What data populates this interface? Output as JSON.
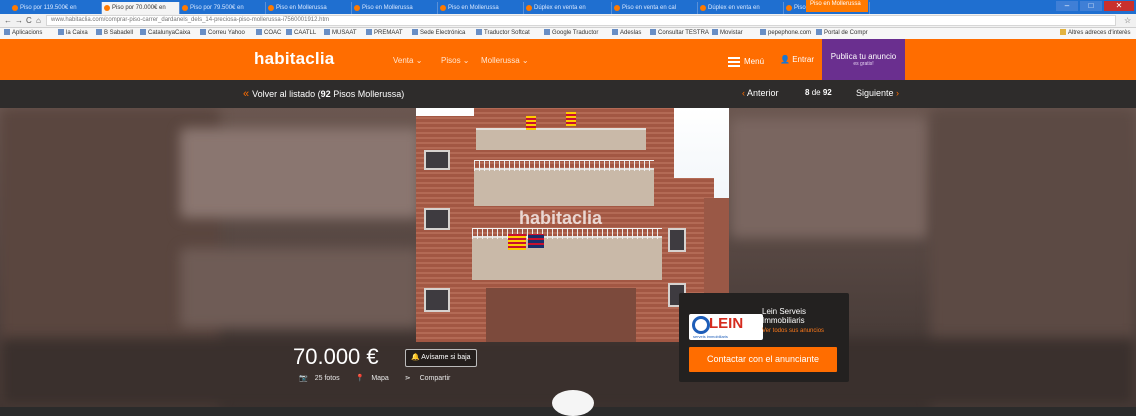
{
  "browser": {
    "tabs": [
      "Piso por 119.500€ en",
      "Piso por 70.000€ en",
      "Piso por 79.500€ en",
      "Piso en Mollerussa",
      "Piso en Mollerussa",
      "Piso en Mollerussa",
      "Dúplex en venta en",
      "Piso en venta en cal",
      "Dúplex en venta en",
      "Piso en venta en Alc"
    ],
    "tab_preview": "Piso en Mollerussa",
    "url": "www.habitaclia.com/comprar-piso-carrer_dardanels_dels_14-preciosa-piso-mollerussa-i7560001912.htm",
    "bookmarks": [
      "Aplicacions",
      "la Caixa",
      "B Sabadell",
      "CatalunyaCaixa",
      "Correu Yahoo",
      "COAC",
      "CAATLL",
      "MUSAAT",
      "PREMAAT",
      "Sede Electrónica",
      "Traductor Softcat",
      "Google Traductor",
      "Adeslas",
      "Consultar TESTRA",
      "Movistar",
      "pepephone.com",
      "Portal de Compr"
    ],
    "bookmarks_other": "Altres adreces d'interès"
  },
  "site": {
    "logo": "habitaclia",
    "nav": [
      "Venta ⌄",
      "Pisos ⌄",
      "Mollerussa ⌄"
    ],
    "menu": "Menú",
    "entrar": "Entrar",
    "publica_title": "Publica tu anuncio",
    "publica_sub": "es gratis!"
  },
  "subnav": {
    "back_prefix": "Volver al listado (",
    "back_count": "92",
    "back_suffix": " Pisos Mollerussa)",
    "prev": "Anterior",
    "current": "8",
    "of": "de",
    "total": "92",
    "next": "Siguiente"
  },
  "listing": {
    "watermark": "habitaclia",
    "price": "70.000 €",
    "alert_button": "Avísame si baja",
    "photos": "25 fotos",
    "map": "Mapa",
    "share": "Compartir"
  },
  "agent": {
    "logo_text": "LEIN",
    "logo_sub": "serveis immobiliaris",
    "name": "Lein Serveis Immobiliaris",
    "link": "Ver todos sus anuncios",
    "contact": "Contactar con el anunciante"
  },
  "colors": {
    "accent": "#ff6d00",
    "publica_bg": "#6a2f8f",
    "subnav_bg": "#2e2c2b"
  }
}
